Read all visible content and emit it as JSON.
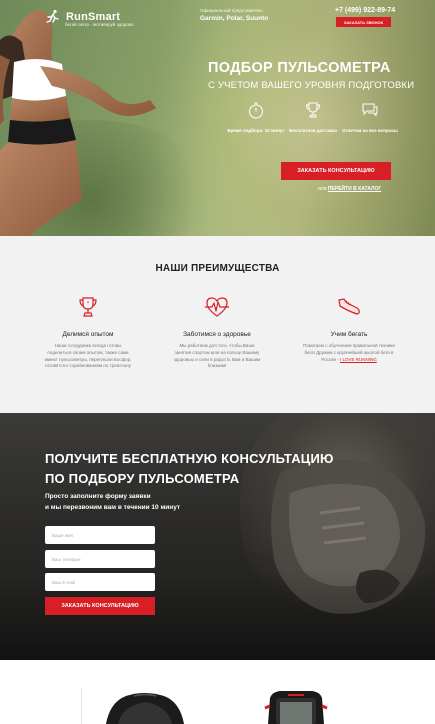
{
  "header": {
    "logo_name": "RunSmart",
    "logo_tagline": "бегай легко - мотивируй здорово",
    "partner_label": "Официальный представитель",
    "partner_brands": "Garmin, Polar, Suunto",
    "phone": "+7 (499) 922-89-74",
    "callback_label": "ЗАКАЗАТЬ ЗВОНОК"
  },
  "hero": {
    "title": "ПОДБОР ПУЛЬСОМЕТРА",
    "subtitle": "С УЧЕТОМ ВАШЕГО УРОВНЯ ПОДГОТОВКИ",
    "features": [
      {
        "label": "Время подбора: 10 минут",
        "icon": "stopwatch-icon"
      },
      {
        "label": "Бесплатная доставка",
        "icon": "trophy-icon"
      },
      {
        "label": "Ответим на все вопросы",
        "icon": "chat-icon"
      }
    ],
    "cta_label": "ЗАКАЗАТЬ КОНСУЛЬТАЦИЮ",
    "or_label": "или",
    "catalog_link": "ПЕРЕЙТИ В КАТАЛОГ"
  },
  "advantages": {
    "title": "НАШИ ПРЕИМУЩЕСТВА",
    "items": [
      {
        "icon": "trophy-icon",
        "heading": "Делимся опытом",
        "text": "Наши сотрудники всегда готовы поделиться своим опытом, также сами имеют пульсометры, переплыли Босфор, готовятся к соревнованиям по триатлону"
      },
      {
        "icon": "heart-pulse-icon",
        "heading": "Заботимся о здоровье",
        "text": "Мы работаем для того, чтобы Ваши занятия спортом шли на пользу Вашему здоровью и сили в радость Вам и Вашим близким!"
      },
      {
        "icon": "sneaker-icon",
        "heading": "Учим бегать",
        "text_before": "Помогаем с обучением правильной технике бега! Дружим с крупнейшей школой бега в России - ",
        "link": "I LOVE RUNNING"
      }
    ]
  },
  "consultation": {
    "title_line1": "ПОЛУЧИТЕ БЕСПЛАТНУЮ КОНСУЛЬТАЦИЮ",
    "title_line2": "ПО ПОДБОРУ ПУЛЬСОМЕТРА",
    "sub_line1": "Просто заполните форму заявки",
    "sub_line2": "и мы перезвоним вам в течении 10 минут",
    "fields": {
      "name_placeholder": "Ваше имя",
      "phone_placeholder": "Ваш телефон",
      "email_placeholder": "Ваш E-mail"
    },
    "submit_label": "ЗАКАЗАТЬ КОНСУЛЬТАЦИЮ"
  },
  "colors": {
    "accent": "#d81f26",
    "dark_section": "#2b2a28",
    "light_section": "#f2f2f2"
  }
}
